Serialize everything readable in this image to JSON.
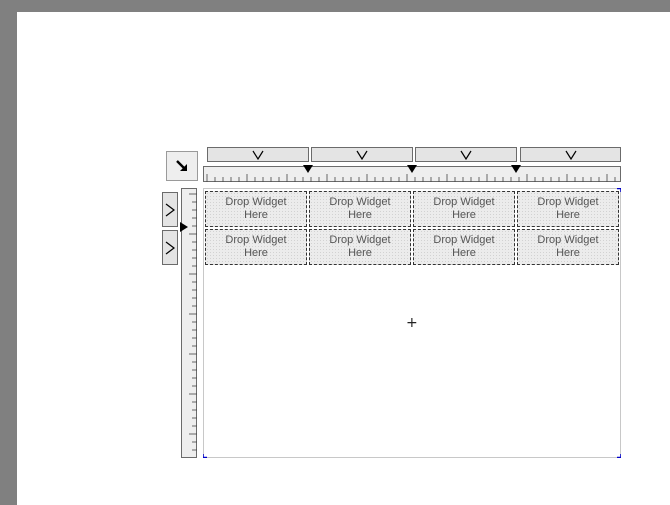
{
  "designer": {
    "grid": {
      "rows": 2,
      "columns": 4,
      "cells": [
        [
          "Drop Widget\nHere",
          "Drop Widget\nHere",
          "Drop Widget\nHere",
          "Drop Widget\nHere"
        ],
        [
          "Drop Widget\nHere",
          "Drop Widget\nHere",
          "Drop Widget\nHere",
          "Drop Widget\nHere"
        ]
      ]
    },
    "column_buttons": [
      {
        "icon": "chevron-down-icon"
      },
      {
        "icon": "chevron-down-icon"
      },
      {
        "icon": "chevron-down-icon"
      },
      {
        "icon": "chevron-down-icon"
      }
    ],
    "row_buttons": [
      {
        "icon": "chevron-right-icon"
      },
      {
        "icon": "chevron-right-icon"
      }
    ],
    "corner_button": {
      "icon": "arrow-down-right-icon"
    },
    "cursor": {
      "icon": "crosshair-icon"
    },
    "colors": {
      "background": "#808080",
      "canvas": "#ffffff",
      "cell_fill": "#ececec",
      "selection_marker": "#0000cc"
    }
  }
}
